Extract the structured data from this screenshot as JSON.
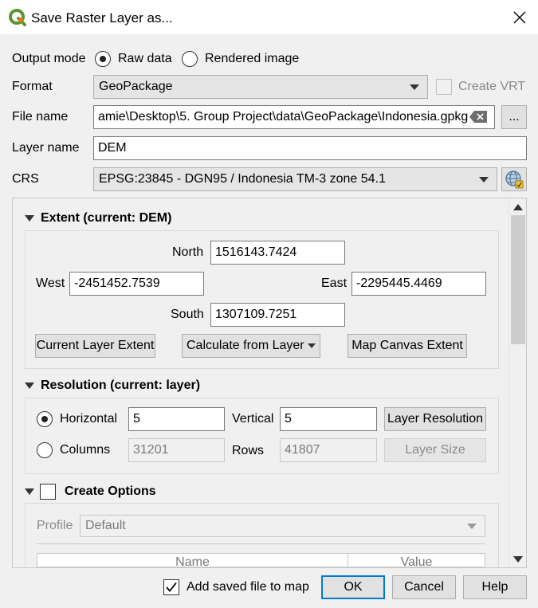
{
  "window": {
    "title": "Save Raster Layer as..."
  },
  "output_mode": {
    "label": "Output mode",
    "options": [
      "Raw data",
      "Rendered image"
    ],
    "selected": "Raw data"
  },
  "format": {
    "label": "Format",
    "value": "GeoPackage",
    "create_vrt_label": "Create VRT",
    "create_vrt_checked": false
  },
  "file_name": {
    "label": "File name",
    "value": "amie\\Desktop\\5. Group Project\\data\\GeoPackage\\Indonesia.gpkg",
    "browse_label": "..."
  },
  "layer_name": {
    "label": "Layer name",
    "value": "DEM"
  },
  "crs": {
    "label": "CRS",
    "value": "EPSG:23845 - DGN95 / Indonesia TM-3 zone 54.1"
  },
  "extent": {
    "title": "Extent (current: DEM)",
    "north_label": "North",
    "north": "1516143.7424",
    "west_label": "West",
    "west": "-2451452.7539",
    "east_label": "East",
    "east": "-2295445.4469",
    "south_label": "South",
    "south": "1307109.7251",
    "current_layer_btn": "Current Layer Extent",
    "calculate_btn": "Calculate from Layer",
    "map_canvas_btn": "Map Canvas Extent"
  },
  "resolution": {
    "title": "Resolution (current: layer)",
    "horizontal_label": "Horizontal",
    "horizontal": "5",
    "vertical_label": "Vertical",
    "vertical": "5",
    "layer_res_btn": "Layer Resolution",
    "columns_label": "Columns",
    "columns": "31201",
    "rows_label": "Rows",
    "rows": "41807",
    "layer_size_btn": "Layer Size",
    "selected": "Horizontal"
  },
  "create_options": {
    "title": "Create Options",
    "checked": false,
    "profile_label": "Profile",
    "profile_value": "Default",
    "table_headers": [
      "Name",
      "Value"
    ]
  },
  "footer": {
    "add_to_map_label": "Add saved file to map",
    "add_to_map_checked": true,
    "ok": "OK",
    "cancel": "Cancel",
    "help": "Help"
  },
  "colors": {
    "accent": "#0078d7",
    "qgis_green": "#589632",
    "qgis_yellow": "#ee7913"
  }
}
